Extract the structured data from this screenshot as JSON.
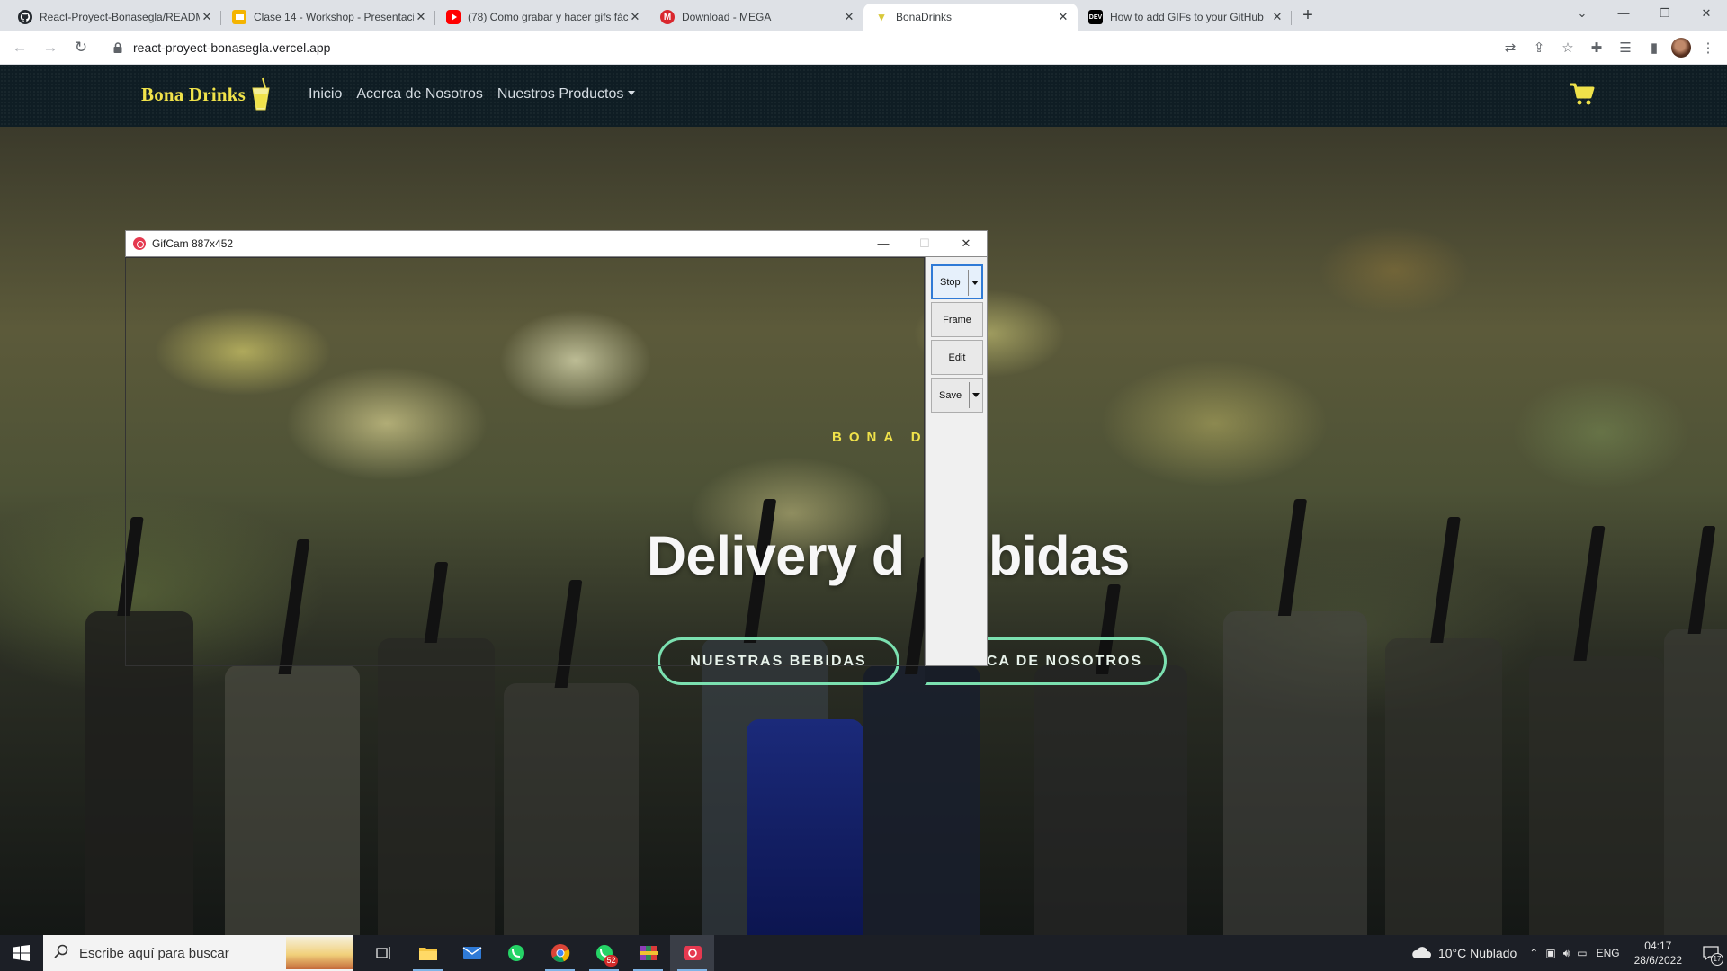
{
  "browser": {
    "tabs": [
      {
        "title": "React-Proyect-Bonasegla/README",
        "favicon": "github-icon",
        "active": false
      },
      {
        "title": "Clase 14 - Workshop - Presentaci",
        "favicon": "google-slides-icon",
        "active": false
      },
      {
        "title": "(78) Como grabar y hacer gifs fác",
        "favicon": "youtube-icon",
        "active": false
      },
      {
        "title": "Download - MEGA",
        "favicon": "mega-icon",
        "active": false
      },
      {
        "title": "BonaDrinks",
        "favicon": "glass-icon",
        "active": true
      },
      {
        "title": "How to add GIFs to your GitHub",
        "favicon": "dev-icon",
        "active": false
      }
    ],
    "url": "react-proyect-bonasegla.vercel.app"
  },
  "site": {
    "brand": "Bona Drinks",
    "nav": {
      "home": "Inicio",
      "about": "Acerca de Nosotros",
      "products": "Nuestros Productos"
    },
    "hero": {
      "tagline": "BONA D",
      "title": "Delivery d",
      "title_end": "ebidas",
      "btn_primary": "NUESTRAS BEBIDAS",
      "btn_secondary": "RCA DE NOSOTROS"
    }
  },
  "gifcam": {
    "title": "GifCam 887x452",
    "buttons": {
      "stop": "Stop",
      "frame": "Frame",
      "edit": "Edit",
      "save": "Save"
    }
  },
  "taskbar": {
    "search_placeholder": "Escribe aquí para buscar",
    "whatsapp_badge": "52",
    "weather": "10°C  Nublado",
    "lang": "ENG",
    "time": "04:17",
    "date": "28/6/2022",
    "notifications": "17"
  },
  "colors": {
    "navbar_bg": "#0f1d24",
    "brand_yellow": "#f0e24a",
    "button_outline": "#7be0b0"
  }
}
